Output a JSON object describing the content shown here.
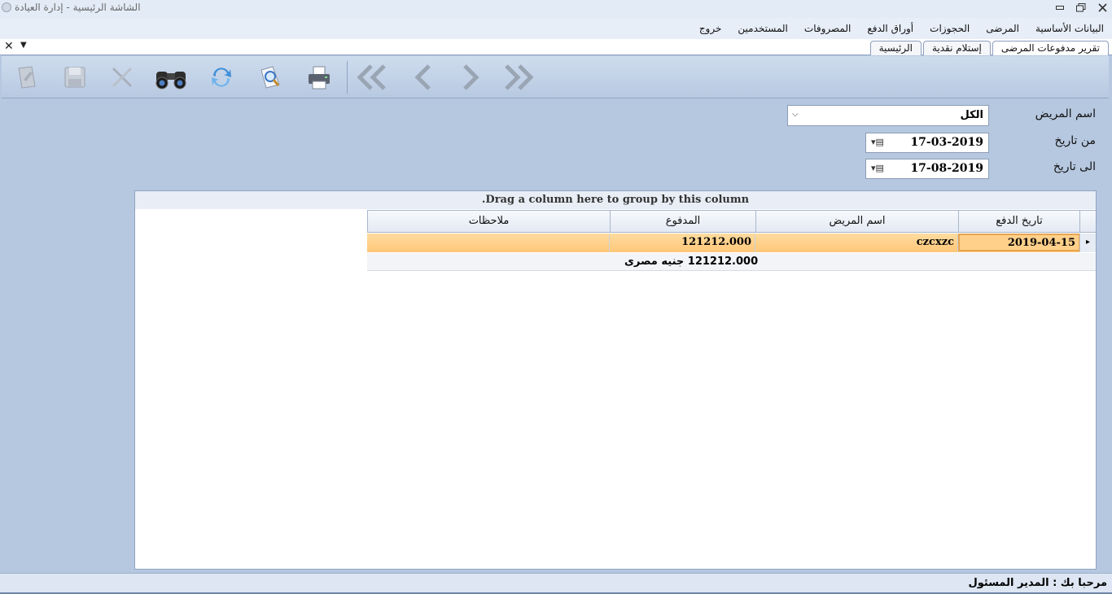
{
  "window": {
    "title": "الشاشة الرئيسية - إدارة العيادة",
    "minimize_icon": "minimize-icon",
    "restore_icon": "restore-icon",
    "close_icon": "close-icon"
  },
  "menu": {
    "items": [
      "البيانات الأساسية",
      "المرضى",
      "الحجوزات",
      "أوراق الدفع",
      "المصروفات",
      "المستخدمين",
      "خروج"
    ]
  },
  "tabs": {
    "items": [
      "تقرير مدفوعات المرضى",
      "إستلام نقدية",
      "الرئيسية"
    ],
    "active_index": 0
  },
  "toolbar": {
    "buttons": [
      {
        "icon": "edit-icon",
        "enabled": false
      },
      {
        "icon": "save-icon",
        "enabled": false
      },
      {
        "icon": "delete-icon",
        "enabled": false
      },
      {
        "icon": "binoculars-search-icon",
        "enabled": true
      },
      {
        "icon": "refresh-icon",
        "enabled": true
      },
      {
        "icon": "print-preview-icon",
        "enabled": true
      },
      {
        "icon": "printer-icon",
        "enabled": true
      },
      {
        "icon": "first-record-icon",
        "enabled": false
      },
      {
        "icon": "previous-record-icon",
        "enabled": false
      },
      {
        "icon": "next-record-icon",
        "enabled": false
      },
      {
        "icon": "last-record-icon",
        "enabled": false
      }
    ]
  },
  "filters": {
    "patient_label": "اسم المريض",
    "patient_value": "الكل",
    "from_label": "من تاريخ",
    "from_value": "17-03-2019",
    "to_label": "الى تاريخ",
    "to_value": "17-08-2019"
  },
  "grid": {
    "group_panel_text": "Drag a column here to group by this column.",
    "columns": [
      "تاريخ الدفع",
      "اسم المريض",
      "المدفوع",
      "ملاحظات"
    ],
    "rows": [
      {
        "date": "2019-04-15",
        "patient": "czcxzc",
        "paid": "121212.000",
        "notes": ""
      }
    ],
    "summary": "121212.000 جنيه مصرى"
  },
  "status": {
    "welcome": "مرحبا بك :  المدير المسئول"
  },
  "colors": {
    "work_area": "#b6c8e0",
    "selected_row": "#ffc778",
    "menu_bar": "#e7eef8"
  }
}
